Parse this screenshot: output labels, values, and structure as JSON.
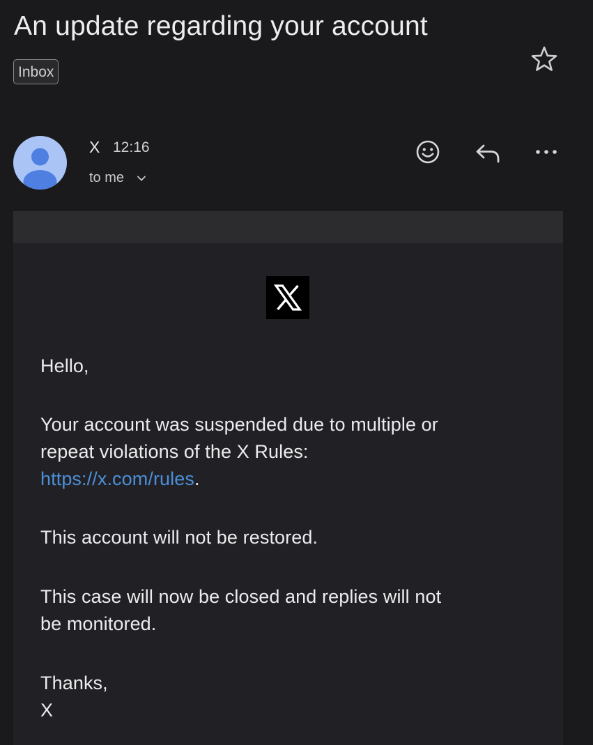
{
  "email": {
    "subject": "An update regarding your account",
    "label": "Inbox",
    "sender": {
      "name": "X",
      "time": "12:16",
      "recipient": "to me"
    },
    "body": {
      "greeting": "Hello,",
      "p1_line1": "Your account was suspended due to multiple or",
      "p1_line2": "repeat violations of the X Rules:",
      "p1_link": "https://x.com/rules",
      "p1_end": ".",
      "p2": "This account will not be restored.",
      "p3_line1": "This case will now be closed and replies will not",
      "p3_line2": "be monitored.",
      "signoff": "Thanks,",
      "signature": "X"
    }
  },
  "icons": {
    "star": "star-icon",
    "avatar": "person-icon",
    "chevron": "chevron-down-icon",
    "emoji": "emoji-reaction-icon",
    "reply": "reply-icon",
    "more": "more-options-icon",
    "logo": "x-logo"
  },
  "colors": {
    "background": "#1a1a1d",
    "card": "#212125",
    "link": "#4c8fd8",
    "avatar": "#a9c4f5",
    "avatar_figure": "#4f7fe0"
  }
}
